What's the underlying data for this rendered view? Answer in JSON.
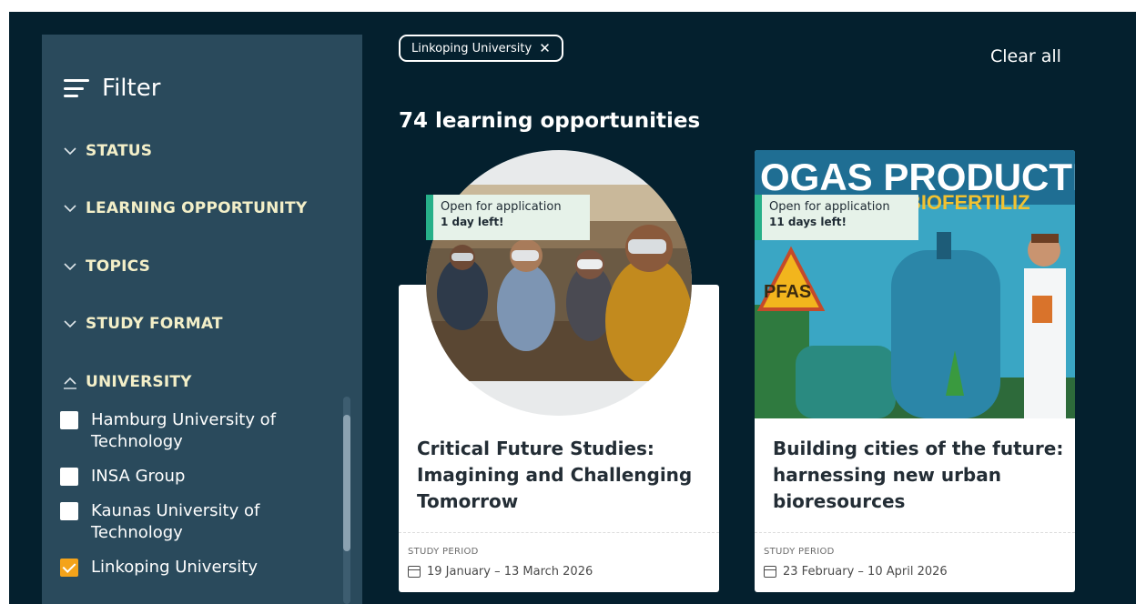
{
  "sidebar": {
    "title": "Filter",
    "sections": [
      {
        "label": "STATUS",
        "expanded": false
      },
      {
        "label": "LEARNING OPPORTUNITY",
        "expanded": false
      },
      {
        "label": "TOPICS",
        "expanded": false
      },
      {
        "label": "STUDY FORMAT",
        "expanded": false
      },
      {
        "label": "UNIVERSITY",
        "expanded": true
      }
    ],
    "universities": [
      {
        "label": "Hamburg University of Technology",
        "checked": false
      },
      {
        "label": "INSA Group",
        "checked": false
      },
      {
        "label": "Kaunas University of Technology",
        "checked": false
      },
      {
        "label": "Linkoping University",
        "checked": true
      }
    ]
  },
  "active_filters": [
    {
      "label": "Linkoping University"
    }
  ],
  "clear_all": "Clear all",
  "result_count": "74 learning opportunities",
  "cards": [
    {
      "status": "Open for application",
      "time_left": "1 day left!",
      "title": "Critical Future Studies: Imagining and Challenging Tomorrow",
      "period_label": "STUDY PERIOD",
      "period": "19 January – 13 March 2026"
    },
    {
      "status": "Open for application",
      "time_left": "11 days left!",
      "title": "Building cities of the future: harnessing new urban bioresources",
      "period_label": "STUDY PERIOD",
      "period": "23 February – 10 April 2026",
      "image_text": {
        "heading": "OGAS PRODUCTI",
        "subheading": "SUSTAINABLE BIOFERTILIZ",
        "sign": "PFAS"
      }
    }
  ],
  "colors": {
    "background": "#04202e",
    "sidebar": "#2a4a5c",
    "section_label": "#f3efc8",
    "checkbox_checked": "#f4a31a",
    "badge_stripe": "#27b089",
    "badge_bg": "#e6f2e9"
  },
  "icons": {
    "filter": "hamburger-icon",
    "section_collapsed": "chevron-down-icon",
    "section_expanded": "chevron-up-icon",
    "chip_remove": "close-icon",
    "study_period": "calendar-icon"
  }
}
